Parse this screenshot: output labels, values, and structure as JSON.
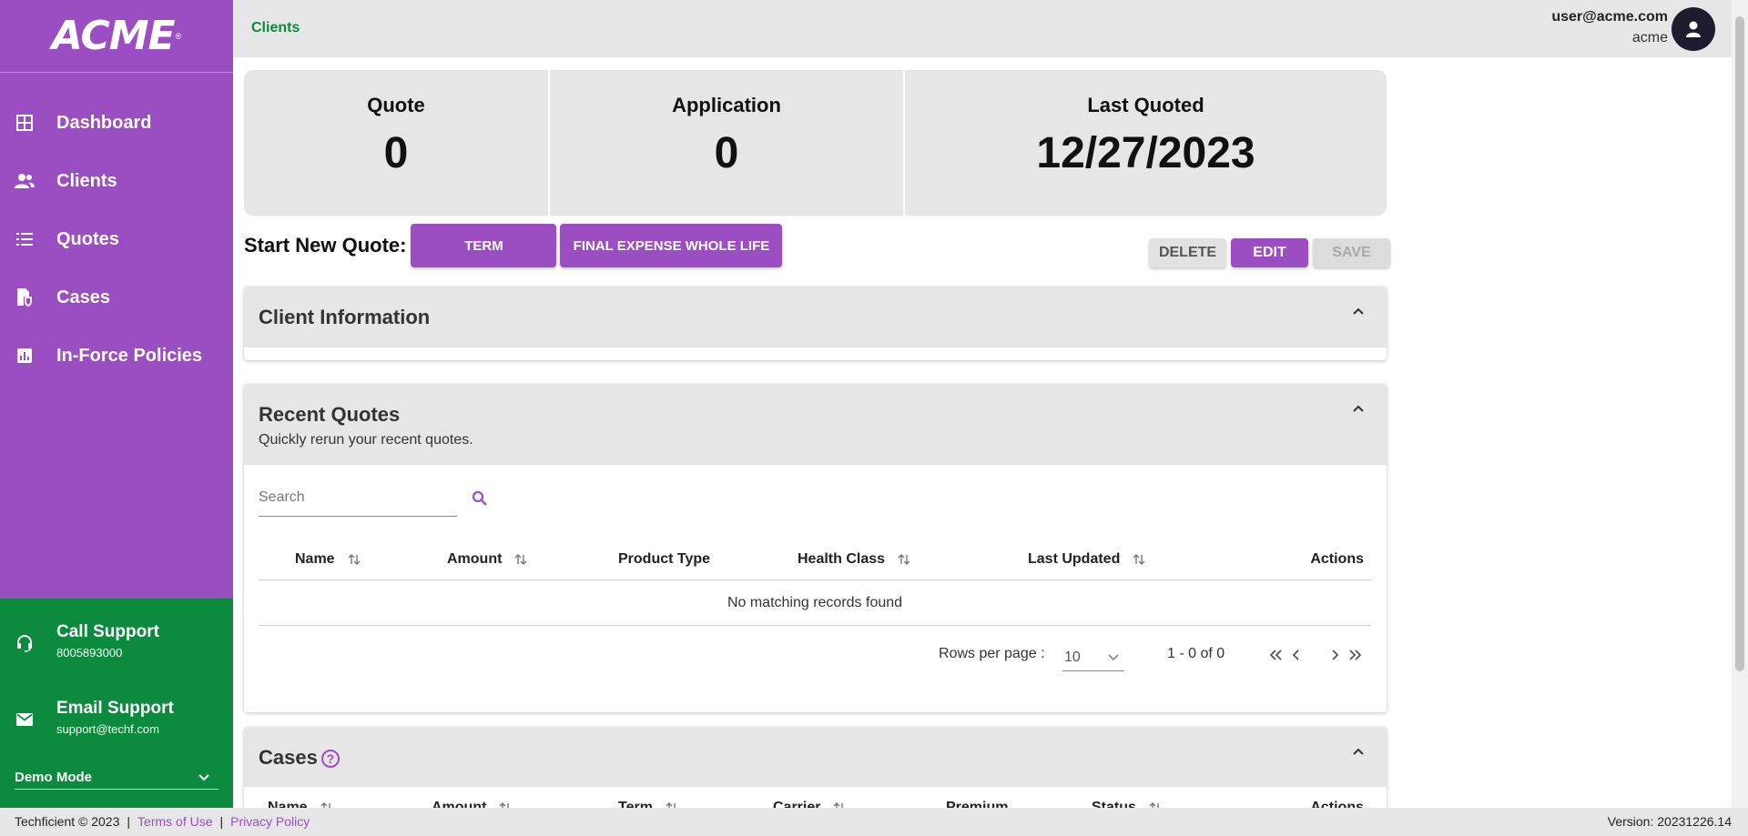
{
  "brand": {
    "logo_text": "ACME",
    "logo_mark": "®"
  },
  "sidebar": {
    "items": [
      {
        "label": "Dashboard",
        "icon": "grid-icon"
      },
      {
        "label": "Clients",
        "icon": "people-icon"
      },
      {
        "label": "Quotes",
        "icon": "list-icon"
      },
      {
        "label": "Cases",
        "icon": "document-shield-icon"
      },
      {
        "label": "In-Force Policies",
        "icon": "chart-icon"
      }
    ],
    "support": {
      "call_title": "Call Support",
      "call_number": "8005893000",
      "email_title": "Email Support",
      "email_address": "support@techf.com"
    },
    "mode": "Demo Mode"
  },
  "header": {
    "breadcrumb": "Clients",
    "user_email": "user@acme.com",
    "user_org": "acme"
  },
  "stats": {
    "quote_label": "Quote",
    "quote_value": "0",
    "application_label": "Application",
    "application_value": "0",
    "last_quoted_label": "Last Quoted",
    "last_quoted_value": "12/27/2023"
  },
  "new_quote": {
    "label": "Start New Quote:",
    "term_button": "TERM",
    "final_expense_button": "FINAL EXPENSE WHOLE LIFE"
  },
  "record_actions": {
    "delete": "DELETE",
    "edit": "EDIT",
    "save": "SAVE"
  },
  "client_info": {
    "title": "Client Information"
  },
  "recent_quotes": {
    "title": "Recent Quotes",
    "subtitle": "Quickly rerun your recent quotes.",
    "search_placeholder": "Search",
    "columns": [
      "Name",
      "Amount",
      "Product Type",
      "Health Class",
      "Last Updated",
      "Actions"
    ],
    "empty_text": "No matching records found",
    "rows_per_page_label": "Rows per page :",
    "rows_per_page": "10",
    "range_text": "1 - 0 of 0"
  },
  "cases": {
    "title": "Cases",
    "help_symbol": "?",
    "columns": [
      "Name",
      "Amount",
      "Term",
      "Carrier",
      "Premium",
      "Status",
      "Actions"
    ]
  },
  "footer": {
    "copyright": "Techficient © 2023",
    "terms": "Terms of Use",
    "privacy": "Privacy Policy",
    "version": "Version: 20231226.14"
  },
  "colors": {
    "brand_purple": "#9b4dc2",
    "support_green": "#0c8a3e",
    "panel_grey": "#e6e6e6"
  }
}
